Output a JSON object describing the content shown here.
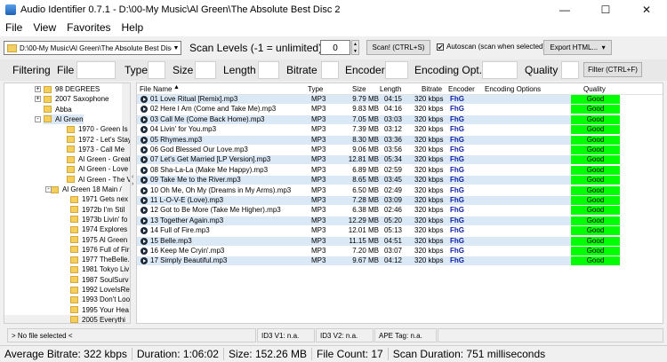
{
  "window": {
    "title": "Audio Identifier 0.7.1  -  D:\\00-My Music\\Al Green\\The Absolute Best Disc 2",
    "icon": "app-icon",
    "controls": [
      "—",
      "☐",
      "✕"
    ]
  },
  "menu": [
    "File",
    "View",
    "Favorites",
    "Help"
  ],
  "toolbar": {
    "path": "D:\\00-My Music\\Al Green\\The Absolute Best Disc 2",
    "scan_levels_label": "Scan Levels (-1 = unlimited)",
    "scan_levels_value": "0",
    "scan_button": "Scan! (CTRL+S)",
    "autoscan_label": "Autoscan (scan when selected)",
    "autoscan_checked": true,
    "export_button": "Export HTML..."
  },
  "filter": {
    "labels": [
      "Filtering",
      "File",
      "Type",
      "Size",
      "Length",
      "Bitrate",
      "Encoder",
      "Encoding Opt.",
      "Quality"
    ],
    "button": "Filter (CTRL+F)"
  },
  "tree": {
    "nodes": [
      {
        "label": "98 DEGREES",
        "expander": "+"
      },
      {
        "label": "2007 Saxophone",
        "expander": "+"
      },
      {
        "label": "Abba",
        "expander": ""
      },
      {
        "label": "Al Green",
        "expander": "-",
        "selected": true
      },
      {
        "label": "1970 - Green Is Bl",
        "expander": ""
      },
      {
        "label": "1972 - Let's Stay T",
        "expander": ""
      },
      {
        "label": "1973 - Call Me",
        "expander": ""
      },
      {
        "label": "Al Green - Greates",
        "expander": ""
      },
      {
        "label": "Al Green - Love &",
        "expander": ""
      },
      {
        "label": "Al Green - The Ver",
        "expander": ""
      },
      {
        "label": "Al Green 18 Main /",
        "expander": "-"
      },
      {
        "label": "1971 Gets nex",
        "expander": ""
      },
      {
        "label": "1972b I'm Stil",
        "expander": ""
      },
      {
        "label": "1973b Livin' fo",
        "expander": ""
      },
      {
        "label": "1974 Explores",
        "expander": ""
      },
      {
        "label": "1975 Al Green",
        "expander": ""
      },
      {
        "label": "1976 Full of Fir",
        "expander": ""
      },
      {
        "label": "1977 TheBelle.",
        "expander": ""
      },
      {
        "label": "1981 Tokyo Liv",
        "expander": ""
      },
      {
        "label": "1987 SoulSurv",
        "expander": ""
      },
      {
        "label": "1992 LoveIsRe",
        "expander": ""
      },
      {
        "label": "1993 Don't Loo",
        "expander": ""
      },
      {
        "label": "1995 Your Hea",
        "expander": ""
      },
      {
        "label": "2005 Everythi",
        "expander": ""
      }
    ]
  },
  "grid": {
    "columns": [
      "File Name",
      "Type",
      "Size",
      "Length",
      "Bitrate",
      "Encoder",
      "Encoding Options",
      "Quality"
    ],
    "rows": [
      [
        "01 Love Ritual [Remix].mp3",
        "MP3",
        "9.79 MB",
        "04:15",
        "320 kbps",
        "FhG",
        "",
        "Good"
      ],
      [
        "02 Here I Am (Come and Take Me).mp3",
        "MP3",
        "9.83 MB",
        "04:16",
        "320 kbps",
        "FhG",
        "",
        "Good"
      ],
      [
        "03 Call Me (Come Back Home).mp3",
        "MP3",
        "7.05 MB",
        "03:03",
        "320 kbps",
        "FhG",
        "",
        "Good"
      ],
      [
        "04 Livin' for You.mp3",
        "MP3",
        "7.39 MB",
        "03:12",
        "320 kbps",
        "FhG",
        "",
        "Good"
      ],
      [
        "05 Rhymes.mp3",
        "MP3",
        "8.30 MB",
        "03:36",
        "320 kbps",
        "FhG",
        "",
        "Good"
      ],
      [
        "06 God Blessed Our Love.mp3",
        "MP3",
        "9.06 MB",
        "03:56",
        "320 kbps",
        "FhG",
        "",
        "Good"
      ],
      [
        "07 Let's Get Married [LP Version].mp3",
        "MP3",
        "12.81 MB",
        "05:34",
        "320 kbps",
        "FhG",
        "",
        "Good"
      ],
      [
        "08 Sha-La-La (Make Me Happy).mp3",
        "MP3",
        "6.89 MB",
        "02:59",
        "320 kbps",
        "FhG",
        "",
        "Good"
      ],
      [
        "09 Take Me to the River.mp3",
        "MP3",
        "8.65 MB",
        "03:45",
        "320 kbps",
        "FhG",
        "",
        "Good"
      ],
      [
        "10 Oh Me, Oh My (Dreams in My Arms).mp3",
        "MP3",
        "6.50 MB",
        "02:49",
        "320 kbps",
        "FhG",
        "",
        "Good"
      ],
      [
        "11 L-O-V-E (Love).mp3",
        "MP3",
        "7.28 MB",
        "03:09",
        "320 kbps",
        "FhG",
        "",
        "Good"
      ],
      [
        "12 Got to Be More (Take Me Higher).mp3",
        "MP3",
        "6.38 MB",
        "02:46",
        "320 kbps",
        "FhG",
        "",
        "Good"
      ],
      [
        "13 Together Again.mp3",
        "MP3",
        "12.29 MB",
        "05:20",
        "320 kbps",
        "FhG",
        "",
        "Good"
      ],
      [
        "14 Full of Fire.mp3",
        "MP3",
        "12.01 MB",
        "05:13",
        "320 kbps",
        "FhG",
        "",
        "Good"
      ],
      [
        "15 Belle.mp3",
        "MP3",
        "11.15 MB",
        "04:51",
        "320 kbps",
        "FhG",
        "",
        "Good"
      ],
      [
        "16 Keep Me Cryin'.mp3",
        "MP3",
        "7.20 MB",
        "03:07",
        "320 kbps",
        "FhG",
        "",
        "Good"
      ],
      [
        "17 Simply Beautiful.mp3",
        "MP3",
        "9.67 MB",
        "04:12",
        "320 kbps",
        "FhG",
        "",
        "Good"
      ]
    ],
    "quality_color": "#00ff00",
    "encoder_color": "#0b1da8"
  },
  "infobar": {
    "selected_file": "> No file selected <",
    "id3v1_label": "ID3 V1:",
    "id3v1_value": "n.a.",
    "id3v2_label": "ID3 V2:",
    "id3v2_value": "n.a.",
    "ape_label": "APE Tag:",
    "ape_value": "n.a."
  },
  "status": {
    "average_bitrate": "Average Bitrate: 322 kbps",
    "duration": "Duration: 1:06:02",
    "size": "Size: 152.26 MB",
    "file_count": "File Count: 17",
    "scan_duration": "Scan Duration: 751 milliseconds"
  }
}
